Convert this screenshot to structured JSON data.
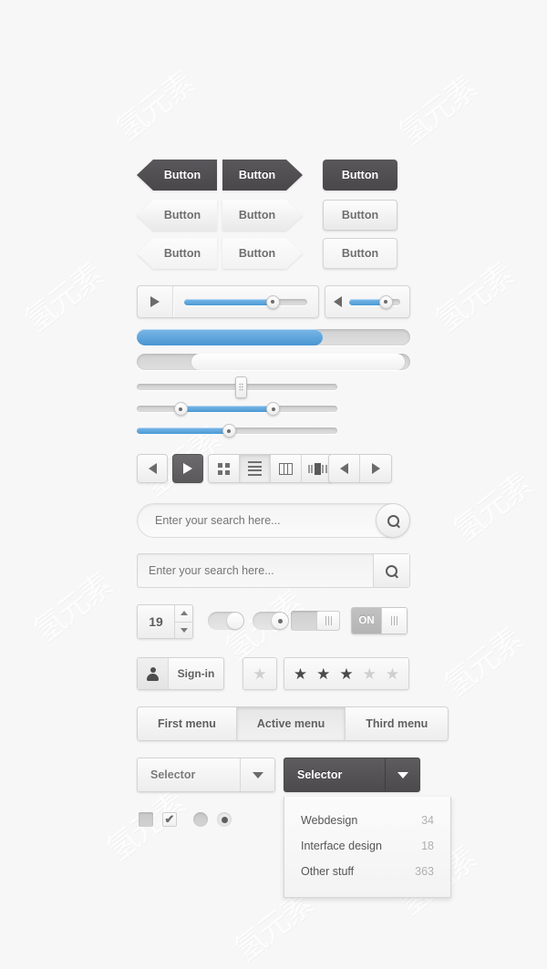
{
  "buttons": {
    "label": "Button",
    "rows": [
      {
        "style": "dark",
        "items": [
          {
            "shape": "arrow-left"
          },
          {
            "shape": "arrow-right"
          },
          {
            "shape": "rect"
          }
        ]
      },
      {
        "style": "light",
        "items": [
          {
            "shape": "arrow-left"
          },
          {
            "shape": "arrow-right"
          },
          {
            "shape": "rect"
          }
        ]
      },
      {
        "style": "light2",
        "items": [
          {
            "shape": "arrow-left"
          },
          {
            "shape": "arrow-right"
          },
          {
            "shape": "rect"
          }
        ]
      }
    ]
  },
  "media": {
    "play_icon": "play-icon",
    "progress_percent": 72,
    "volume_icon": "speaker-icon",
    "volume_percent": 72
  },
  "progress_bars": [
    {
      "name": "progress-blue",
      "percent": 68,
      "fill": "blue"
    },
    {
      "name": "progress-white",
      "percent": 78,
      "offset": 20,
      "fill": "white"
    }
  ],
  "sliders": [
    {
      "name": "slider-grip",
      "handle": "rect-grip",
      "value": 52,
      "fill": 0
    },
    {
      "name": "slider-range",
      "handle": "dual",
      "low": 22,
      "high": 68,
      "fill": 46
    },
    {
      "name": "slider-single",
      "handle": "single",
      "value": 46,
      "fill": 46
    }
  ],
  "segmented": {
    "transport": [
      {
        "icon": "arrow-left-icon",
        "active": false
      },
      {
        "icon": "arrow-right-icon",
        "active": true
      }
    ],
    "views": [
      {
        "icon": "grid-view-icon",
        "active": false
      },
      {
        "icon": "list-view-icon",
        "active": true
      },
      {
        "icon": "column-view-icon",
        "active": false
      },
      {
        "icon": "coverflow-view-icon",
        "active": false
      }
    ],
    "pager": [
      {
        "icon": "arrow-left-icon"
      },
      {
        "icon": "arrow-right-icon"
      }
    ]
  },
  "search": {
    "placeholder": "Enter your search here...",
    "value": "",
    "icon": "search-icon"
  },
  "stepper": {
    "value": "19",
    "up_icon": "caret-up-icon",
    "down_icon": "caret-down-icon"
  },
  "toggles": {
    "switch_plain": {
      "state": "on",
      "knob": "plain"
    },
    "switch_dot": {
      "state": "on",
      "knob": "dot"
    },
    "switch_rect": {
      "state": "on",
      "knob": "grip"
    },
    "switch_on": {
      "label": "ON",
      "state": "on",
      "knob": "grip"
    }
  },
  "signin": {
    "label": "Sign-in",
    "icon": "user-icon"
  },
  "rating": {
    "single_star": {
      "filled": false
    },
    "stars": [
      true,
      true,
      true,
      false,
      false
    ],
    "glyph": "★"
  },
  "menu_tabs": [
    {
      "label": "First menu",
      "active": false
    },
    {
      "label": "Active menu",
      "active": true
    },
    {
      "label": "Third menu",
      "active": false
    }
  ],
  "selectors": [
    {
      "label": "Selector",
      "theme": "light",
      "icon": "chevron-down-icon"
    },
    {
      "label": "Selector",
      "theme": "dark",
      "icon": "chevron-down-icon"
    }
  ],
  "dropdown": {
    "items": [
      {
        "name": "Webdesign",
        "count": "34"
      },
      {
        "name": "Interface design",
        "count": "18"
      },
      {
        "name": "Other stuff",
        "count": "363"
      }
    ]
  },
  "form_controls": {
    "checkbox_unchecked": {
      "checked": false
    },
    "checkbox_checked": {
      "checked": true,
      "glyph": "✔"
    },
    "radio_unselected": {
      "selected": false
    },
    "radio_selected": {
      "selected": true
    }
  },
  "colors": {
    "accent_blue_top": "#7bb8e8",
    "accent_blue_bottom": "#4a9ad4",
    "dark_button": "#59575a",
    "background": "#f7f7f7",
    "text_gray": "#6e6e6e"
  },
  "watermark": {
    "text": "氢元素"
  }
}
